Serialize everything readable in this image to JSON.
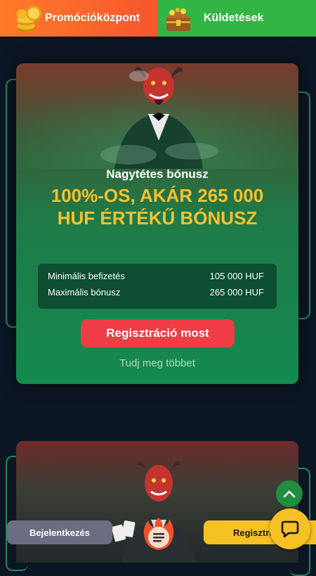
{
  "tabs": [
    {
      "label": "Promócióközpont",
      "icon": "coins-icon"
    },
    {
      "label": "Küldetések",
      "icon": "treasure-chest-icon"
    }
  ],
  "bonus": {
    "kicker": "Nagytétes bónusz",
    "title": "100%-OS, AKÁR 265 000 HUF ÉRTÉKŰ BÓNUSZ",
    "details": [
      {
        "label": "Minimális befizetés",
        "value": "105 000 HUF"
      },
      {
        "label": "Maximális bónusz",
        "value": "265 000 HUF"
      }
    ],
    "cta": "Regisztráció most",
    "more": "Tudj meg többet"
  },
  "bottom_bar": {
    "login": "Bejelentkezés",
    "register": "Regisztrá",
    "menu_icon": "menu-icon",
    "chat_icon": "chat-icon",
    "scroll_icon": "chevron-up-icon"
  },
  "colors": {
    "accent_yellow": "#f6c12b",
    "cta_red": "#f03d45",
    "card_green": "#138a4e",
    "promo_orange": "#f7562c",
    "quest_green": "#32b544"
  }
}
